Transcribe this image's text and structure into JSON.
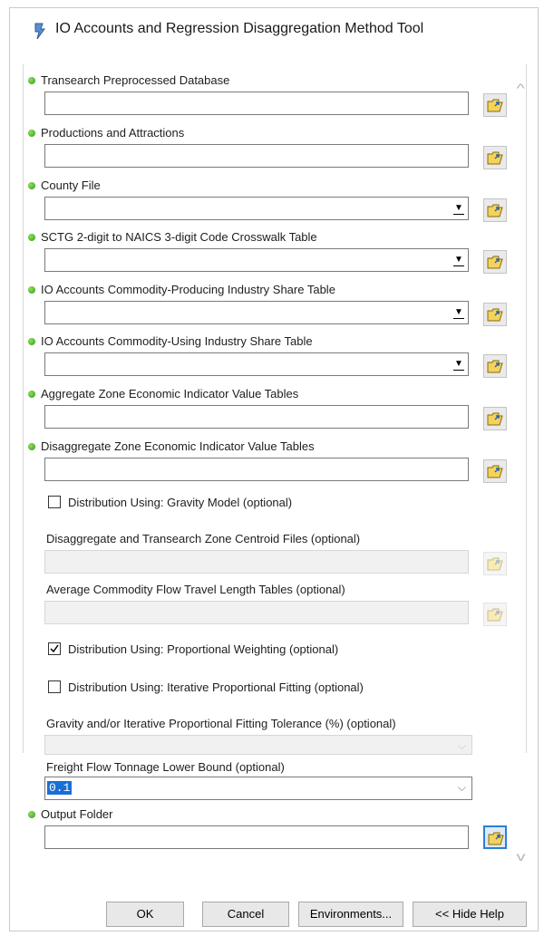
{
  "window": {
    "title": "IO Accounts and Regression Disaggregation Method Tool",
    "title_icon": "toolbox-icon"
  },
  "params": {
    "transearch_db": {
      "label": "Transearch Preprocessed Database",
      "value": ""
    },
    "productions_attractions": {
      "label": "Productions and Attractions",
      "value": ""
    },
    "county_file": {
      "label": "County File",
      "value": ""
    },
    "sctg_crosswalk": {
      "label": "SCTG 2-digit to NAICS 3-digit Code Crosswalk Table",
      "value": ""
    },
    "io_producing": {
      "label": "IO Accounts Commodity-Producing Industry Share Table",
      "value": ""
    },
    "io_using": {
      "label": "IO Accounts Commodity-Using Industry Share Table",
      "value": ""
    },
    "aggregate_zone": {
      "label": "Aggregate Zone Economic Indicator Value Tables",
      "value": ""
    },
    "disaggregate_zone": {
      "label": "Disaggregate Zone Economic Indicator Value Tables",
      "value": ""
    },
    "gravity_model": {
      "label": "Distribution Using: Gravity Model (optional)",
      "checked": false
    },
    "centroid_files": {
      "label": "Disaggregate and Transearch Zone Centroid Files (optional)",
      "value": ""
    },
    "travel_length": {
      "label": "Average Commodity Flow Travel Length Tables (optional)",
      "value": ""
    },
    "proportional_weighting": {
      "label": "Distribution Using: Proportional Weighting (optional)",
      "checked": true
    },
    "ipf": {
      "label": "Distribution Using: Iterative Proportional Fitting (optional)",
      "checked": false
    },
    "tolerance": {
      "label": "Gravity and/or Iterative Proportional Fitting Tolerance (%) (optional)",
      "value": ""
    },
    "tonnage_lower_bound": {
      "label": "Freight Flow Tonnage Lower Bound (optional)",
      "value": "0.1"
    },
    "output_folder": {
      "label": "Output Folder",
      "value": ""
    }
  },
  "buttons": {
    "ok": "OK",
    "cancel": "Cancel",
    "environments": "Environments...",
    "hide_help": "<< Hide Help"
  },
  "colors": {
    "required_dot": "#2f9a1a",
    "selection": "#1a6fd6",
    "browse_active_border": "#2d7fd3"
  }
}
